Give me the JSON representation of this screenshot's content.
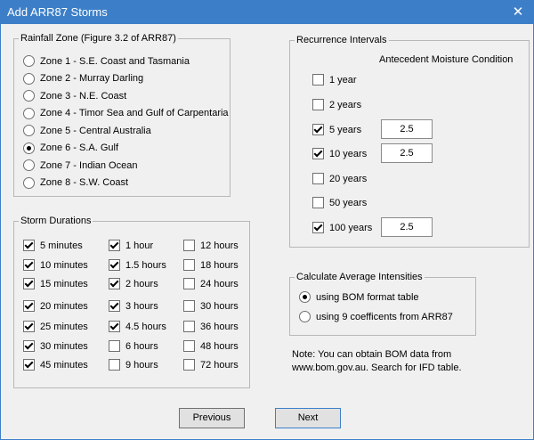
{
  "window": {
    "title": "Add ARR87 Storms",
    "close": "✕"
  },
  "rainfall_zone": {
    "legend": "Rainfall Zone (Figure 3.2 of ARR87)",
    "selected_index": 5,
    "options": [
      "Zone 1 - S.E. Coast and Tasmania",
      "Zone 2 - Murray Darling",
      "Zone 3 - N.E. Coast",
      "Zone 4 - Timor Sea and Gulf of Carpentaria",
      "Zone 5 - Central Australia",
      "Zone 6 - S.A. Gulf",
      "Zone 7 - Indian Ocean",
      "Zone 8 - S.W. Coast"
    ]
  },
  "storm_durations": {
    "legend": "Storm Durations",
    "columns": [
      [
        {
          "label": "5 minutes",
          "checked": true
        },
        {
          "label": "10 minutes",
          "checked": true
        },
        {
          "label": "15 minutes",
          "checked": true
        },
        {
          "label": "20 minutes",
          "checked": true
        },
        {
          "label": "25 minutes",
          "checked": true
        },
        {
          "label": "30 minutes",
          "checked": true
        },
        {
          "label": "45 minutes",
          "checked": true
        }
      ],
      [
        {
          "label": "1 hour",
          "checked": true
        },
        {
          "label": "1.5 hours",
          "checked": true
        },
        {
          "label": "2 hours",
          "checked": true
        },
        {
          "label": "3 hours",
          "checked": true
        },
        {
          "label": "4.5 hours",
          "checked": true
        },
        {
          "label": "6 hours",
          "checked": false
        },
        {
          "label": "9 hours",
          "checked": false
        }
      ],
      [
        {
          "label": "12 hours",
          "checked": false
        },
        {
          "label": "18 hours",
          "checked": false
        },
        {
          "label": "24 hours",
          "checked": false
        },
        {
          "label": "30 hours",
          "checked": false
        },
        {
          "label": "36 hours",
          "checked": false
        },
        {
          "label": "48 hours",
          "checked": false
        },
        {
          "label": "72 hours",
          "checked": false
        }
      ]
    ]
  },
  "recurrence": {
    "legend": "Recurrence Intervals",
    "amc_header": "Antecedent Moisture Condition",
    "items": [
      {
        "label": "1 year",
        "checked": false,
        "amc": null
      },
      {
        "label": "2 years",
        "checked": false,
        "amc": null
      },
      {
        "label": "5 years",
        "checked": true,
        "amc": "2.5"
      },
      {
        "label": "10 years",
        "checked": true,
        "amc": "2.5"
      },
      {
        "label": "20 years",
        "checked": false,
        "amc": null
      },
      {
        "label": "50 years",
        "checked": false,
        "amc": null
      },
      {
        "label": "100 years",
        "checked": true,
        "amc": "2.5"
      }
    ]
  },
  "intensities": {
    "legend": "Calculate Average Intensities",
    "selected_index": 0,
    "options": [
      "using BOM format table",
      "using 9 coefficents from ARR87"
    ]
  },
  "note": {
    "line1": "Note:  You can obtain BOM data from",
    "line2": "www.bom.gov.au.  Search for IFD table."
  },
  "buttons": {
    "previous": "Previous",
    "next": "Next"
  }
}
